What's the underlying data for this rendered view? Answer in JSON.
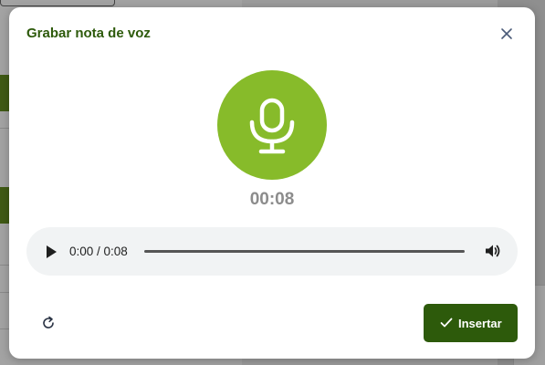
{
  "modal": {
    "title": "Grabar nota de voz",
    "timer": "00:08",
    "colors": {
      "title": "#2d5a0b",
      "mic_circle": "#87bb2a",
      "primary_button": "#2d5a0b",
      "timer_text": "#8c8c8c"
    },
    "icons": {
      "close": "close-icon",
      "mic": "microphone-icon",
      "play": "play-icon",
      "volume": "volume-icon",
      "reset": "refresh-icon",
      "check": "check-icon"
    }
  },
  "audio_player": {
    "time": "0:00 / 0:08",
    "progress_fraction": 0.0
  },
  "actions": {
    "insert_label": "Insertar"
  }
}
